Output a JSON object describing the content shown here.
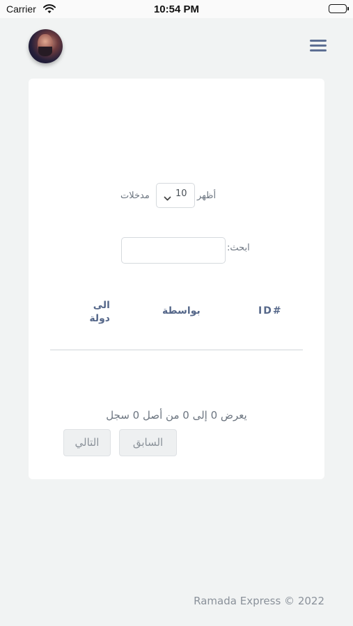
{
  "status_bar": {
    "carrier": "Carrier",
    "time": "10:54 PM",
    "icons": [
      "wifi-icon",
      "battery-icon"
    ]
  },
  "header": {
    "avatar": "user-avatar",
    "menu_icon": "hamburger-menu-icon"
  },
  "table_controls": {
    "length": {
      "prefix": "أظهر",
      "selected": "10",
      "suffix": "مدخلات"
    },
    "search": {
      "label": "ابحث:",
      "value": "",
      "placeholder": ""
    }
  },
  "table": {
    "columns": [
      "ID#",
      "بواسطة",
      "الى دولة"
    ],
    "column_to_line1": "الى",
    "column_to_line2": "دولة",
    "rows": []
  },
  "pagination": {
    "info": "يعرض 0 إلى 0 من أصل 0 سجل",
    "previous_label": "السابق",
    "next_label": "التالي"
  },
  "footer": {
    "copyright": "Ramada Express © 2022"
  },
  "colors": {
    "background": "#f1f3f3",
    "card": "#ffffff",
    "header_text": "#56688a",
    "menu_icon": "#5d6f93"
  }
}
